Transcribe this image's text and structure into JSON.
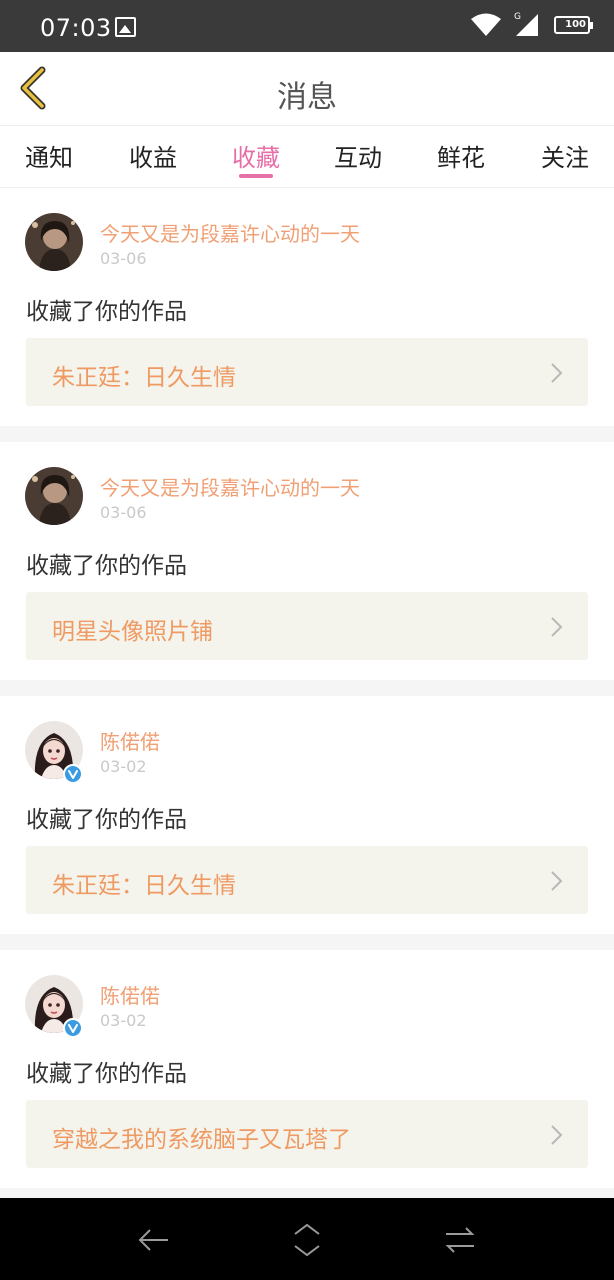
{
  "status_bar": {
    "time": "07:03",
    "signal_label": "G",
    "battery": "100"
  },
  "header": {
    "title": "消息"
  },
  "tabs": [
    {
      "label": "通知"
    },
    {
      "label": "收益"
    },
    {
      "label": "收藏",
      "active": true
    },
    {
      "label": "互动"
    },
    {
      "label": "鲜花"
    },
    {
      "label": "关注"
    }
  ],
  "messages": [
    {
      "username": "今天又是为段嘉许心动的一天",
      "date": "03-06",
      "action": "收藏了你的作品",
      "work_title": "朱正廷：日久生情",
      "avatar": "avatar-photo",
      "verified": false
    },
    {
      "username": "今天又是为段嘉许心动的一天",
      "date": "03-06",
      "action": "收藏了你的作品",
      "work_title": "明星头像照片铺",
      "avatar": "avatar-photo",
      "verified": false
    },
    {
      "username": "陈偌偌",
      "date": "03-02",
      "action": "收藏了你的作品",
      "work_title": "朱正廷：日久生情",
      "avatar": "avatar-illustration",
      "verified": true
    },
    {
      "username": "陈偌偌",
      "date": "03-02",
      "action": "收藏了你的作品",
      "work_title": "穿越之我的系统脑子又瓦塔了",
      "avatar": "avatar-illustration",
      "verified": true
    }
  ],
  "colors": {
    "accent": "#e76fa8",
    "username": "#f0a074",
    "work_title": "#ef9a63",
    "back_arrow": "#e8c23a"
  }
}
